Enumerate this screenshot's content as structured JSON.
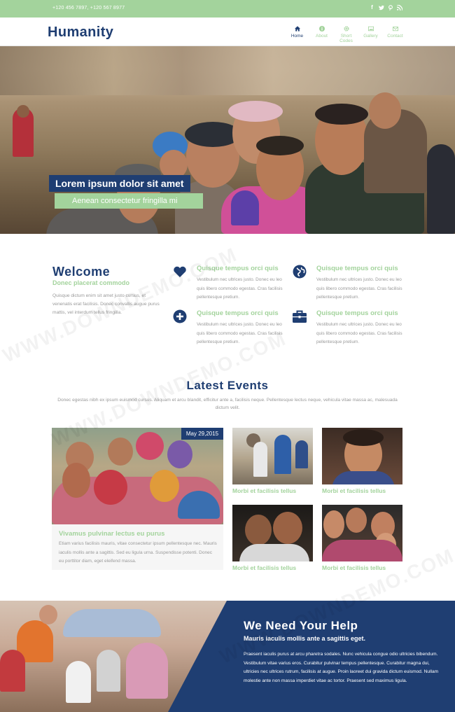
{
  "topbar": {
    "phones": "+120 456 7897, +120 567 8977",
    "social": [
      "f",
      "t",
      "p",
      "rss"
    ]
  },
  "header": {
    "logo": "Humanity",
    "nav": [
      {
        "label": "Home",
        "icon": "home-icon",
        "active": true
      },
      {
        "label": "About",
        "icon": "info-icon",
        "active": false
      },
      {
        "label": "Short Codes",
        "icon": "gear-icon",
        "active": false
      },
      {
        "label": "Gallery",
        "icon": "image-icon",
        "active": false
      },
      {
        "label": "Contact",
        "icon": "mail-icon",
        "active": false
      }
    ]
  },
  "hero": {
    "title": "Lorem ipsum dolor sit amet",
    "subtitle": "Aenean consectetur fringilla mi"
  },
  "welcome": {
    "title": "Welcome",
    "subtitle": "Donec placerat commodo",
    "text": "Quisque dictum enim sit amet justo cursus, et venenatis erat facilisis. Donec convallis augue purus mattis, vel interdum tellus fringilla."
  },
  "features": [
    {
      "title": "Quisque tempus orci quis",
      "icon": "heart-icon",
      "text": "Vestibulum nec ultrices justo. Donec eu leo quis libero commodo egestas. Cras facilisis pellentesque pretium."
    },
    {
      "title": "Quisque tempus orci quis",
      "icon": "globe-icon",
      "text": "Vestibulum nec ultrices justo. Donec eu leo quis libero commodo egestas. Cras facilisis pellentesque pretium."
    },
    {
      "title": "Quisque tempus orci quis",
      "icon": "plus-circle-icon",
      "text": "Vestibulum nec ultrices justo. Donec eu leo quis libero commodo egestas. Cras facilisis pellentesque pretium."
    },
    {
      "title": "Quisque tempus orci quis",
      "icon": "briefcase-icon",
      "text": "Vestibulum nec ultrices justo. Donec eu leo quis libero commodo egestas. Cras facilisis pellentesque pretium."
    }
  ],
  "events": {
    "title": "Latest Events",
    "description": "Donec egestas nibh ex ipsum euismod cursus. Aliquam et arcu blandit, efficitur ante a, facilisis neque. Pellentesque lectus neque, vehicula vitae massa ac, malesuada dictum velit.",
    "featured": {
      "date": "May 29,2015",
      "title": "Vivamus pulvinar lectus eu purus",
      "text": "Etiam varius facilisis mauris, vitae consectetur ipsum pellentesque nec. Mauris iaculis mollis ante a sagittis. Sed eu ligula urna. Suspendisse potenti. Donec eu porttitor diam, eget eleifend massa."
    },
    "thumbs": [
      {
        "label": "Morbi et facilisis tellus"
      },
      {
        "label": "Morbi et facilisis tellus"
      },
      {
        "label": "Morbi et facilisis tellus"
      },
      {
        "label": "Morbi et facilisis tellus"
      }
    ]
  },
  "help": {
    "title": "We Need Your Help",
    "subtitle": "Mauris iaculis mollis ante a sagittis eget.",
    "text": "Praesent iaculis purus at arcu pharetra sodales. Nunc vehicula congue odio ultricies bibendum. Vestibulum vitae varius eros. Curabitur pulvinar tempus pellentesque. Curabitur magna dui, ultricies nec ultrices rutrum, facilisis at augue. Proin laoreet dui gravida dictum euismod. Nullam molestie ante non massa imperdiet vitae ac tortor. Praesent sed maximus ligula."
  },
  "watermark": "WWW.DOWNDEMO.COM",
  "colors": {
    "navy": "#1f3e72",
    "green": "#a3d39c"
  }
}
